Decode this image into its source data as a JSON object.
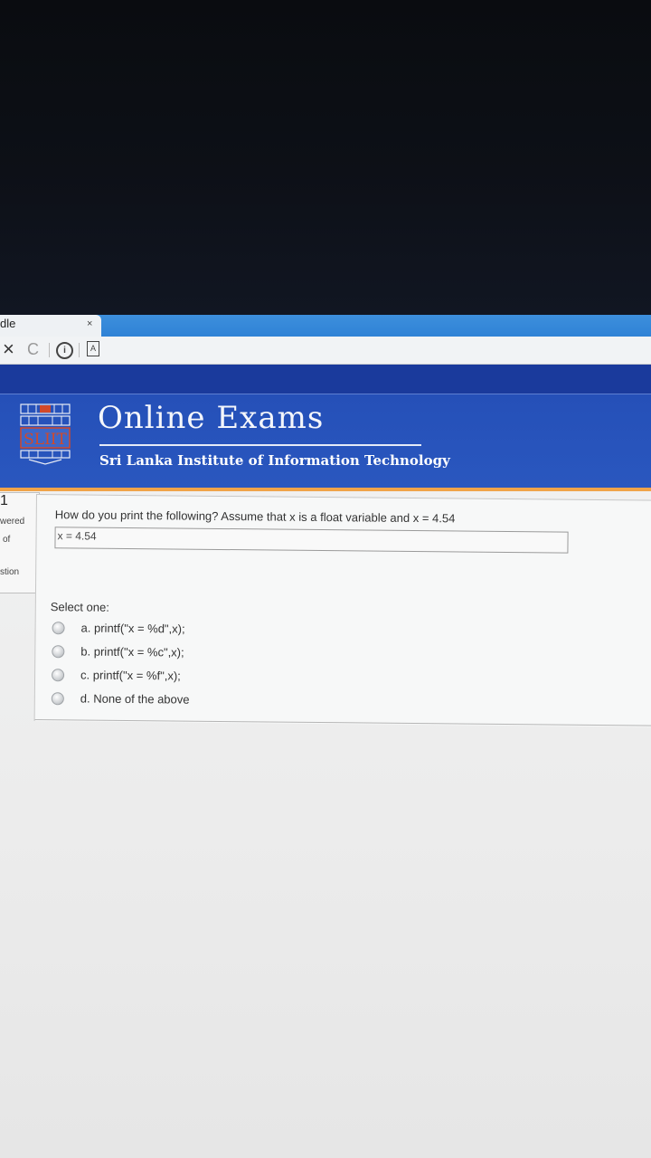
{
  "browser": {
    "tab_title": "dle",
    "tab_close": "×",
    "stop_icon": "×",
    "reload_icon": "C",
    "info_icon": "i",
    "page_icon": "A"
  },
  "site": {
    "logo_text": "SLIIT",
    "title": "Online Exams",
    "subtitle": "Sri Lanka Institute of Information Technology"
  },
  "question_info": {
    "number": "1",
    "status": "wered",
    "marks": "of",
    "flag": "stion"
  },
  "question": {
    "text": "How do you print the following? Assume that x is a float variable and x = 4.54",
    "code": "x = 4.54",
    "select_label": "Select one:",
    "options": [
      {
        "label": "a. printf(\"x = %d\",x);"
      },
      {
        "label": "b. printf(\"x = %c\",x);"
      },
      {
        "label": "c. printf(\"x = %f\",x);"
      },
      {
        "label": "d. None of the above"
      }
    ]
  },
  "colors": {
    "header_blue": "#2a57bf",
    "navbar_blue": "#1a3a9c",
    "accent_orange": "#f0a349"
  }
}
